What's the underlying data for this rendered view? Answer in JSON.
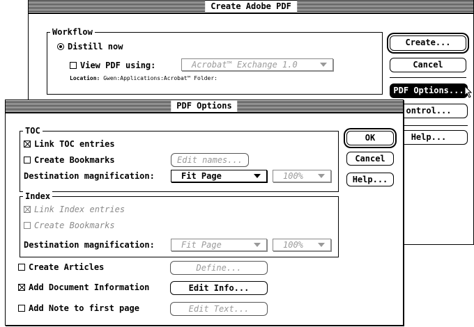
{
  "create_dialog": {
    "title": "Create Adobe PDF",
    "workflow_legend": "Workflow",
    "distill_now": "Distill now",
    "view_pdf_using": "View PDF using:",
    "view_app": "Acrobat™ Exchange 1.0",
    "location_label": "Location:",
    "location_value": "Gwen:Applications:Acrobat™ Folder:",
    "buttons": {
      "create": "Create...",
      "cancel": "Cancel",
      "pdf_options": "PDF Options...",
      "control": "ontrol...",
      "help": "Help..."
    }
  },
  "pdf_options": {
    "title": "PDF Options",
    "toc": {
      "legend": "TOC",
      "link_entries": "Link TOC entries",
      "create_bookmarks": "Create Bookmarks",
      "edit_names": "Edit names...",
      "dest_label": "Destination magnification:",
      "dest_value": "Fit Page",
      "zoom_value": "100%"
    },
    "index": {
      "legend": "Index",
      "link_entries": "Link Index entries",
      "create_bookmarks": "Create Bookmarks",
      "dest_label": "Destination magnification:",
      "dest_value": "Fit Page",
      "zoom_value": "100%"
    },
    "create_articles": "Create Articles",
    "define": "Define...",
    "add_doc_info": "Add Document Information",
    "edit_info": "Edit Info...",
    "add_note": "Add Note to first page",
    "edit_text": "Edit Text...",
    "buttons": {
      "ok": "OK",
      "cancel": "Cancel",
      "help": "Help..."
    }
  }
}
